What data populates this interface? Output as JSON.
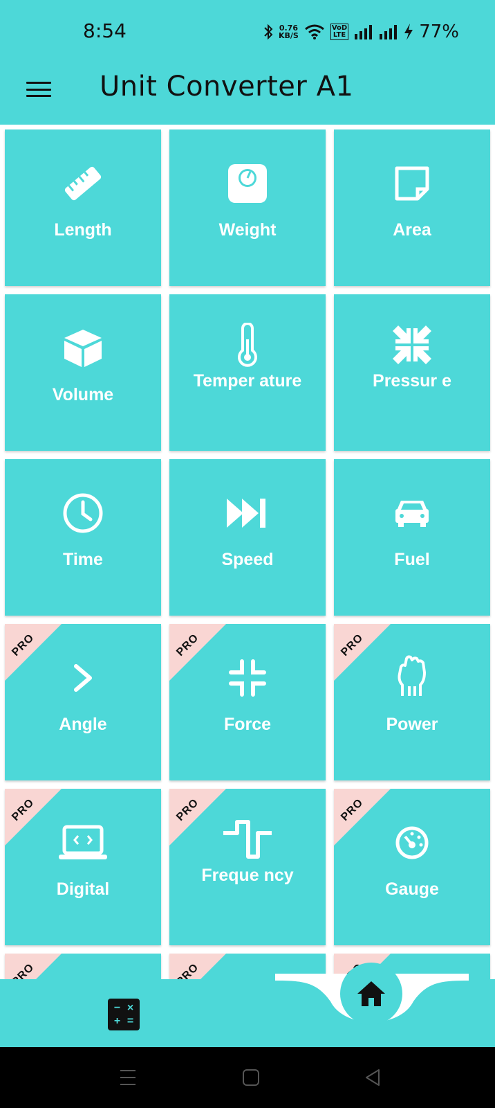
{
  "status_bar": {
    "time": "8:54",
    "net_speed_value": "0.76",
    "net_speed_unit": "KB/S",
    "volte_top": "VoD",
    "volte_bottom": "LTE",
    "battery": "77%",
    "icons": [
      "bluetooth-icon",
      "wifi-icon",
      "signal-icon",
      "signal-icon",
      "charging-icon"
    ]
  },
  "app_bar": {
    "title": "Unit Converter A1",
    "menu_icon": "hamburger-menu-icon"
  },
  "colors": {
    "accent": "#4dd8d8",
    "pro_ribbon": "#f9d6d3",
    "text_dark": "#111111",
    "tile_text": "#ffffff"
  },
  "tiles": [
    {
      "label": "Length",
      "icon": "ruler-icon",
      "pro": false
    },
    {
      "label": "Weight",
      "icon": "scale-icon",
      "pro": false
    },
    {
      "label": "Area",
      "icon": "area-square-icon",
      "pro": false
    },
    {
      "label": "Volume",
      "icon": "cube-icon",
      "pro": false
    },
    {
      "label": "Temper ature",
      "icon": "thermometer-icon",
      "pro": false
    },
    {
      "label": "Pressur e",
      "icon": "compress-arrows-icon",
      "pro": false
    },
    {
      "label": "Time",
      "icon": "clock-icon",
      "pro": false
    },
    {
      "label": "Speed",
      "icon": "fast-forward-icon",
      "pro": false
    },
    {
      "label": "Fuel",
      "icon": "car-icon",
      "pro": false
    },
    {
      "label": "Angle",
      "icon": "chevron-right-icon",
      "pro": true
    },
    {
      "label": "Force",
      "icon": "compress-corners-icon",
      "pro": true
    },
    {
      "label": "Power",
      "icon": "fist-icon",
      "pro": true
    },
    {
      "label": "Digital",
      "icon": "laptop-code-icon",
      "pro": true
    },
    {
      "label": "Freque ncy",
      "icon": "square-wave-icon",
      "pro": true
    },
    {
      "label": "Gauge",
      "icon": "gauge-icon",
      "pro": true
    }
  ],
  "partial_row_pro": [
    true,
    true,
    true
  ],
  "pro_badge": "PRO",
  "bottom_nav": {
    "left_icon": "calculator-icon",
    "center_icon": "home-icon"
  },
  "system_nav": [
    "recents-icon",
    "home-square-icon",
    "back-triangle-icon"
  ]
}
